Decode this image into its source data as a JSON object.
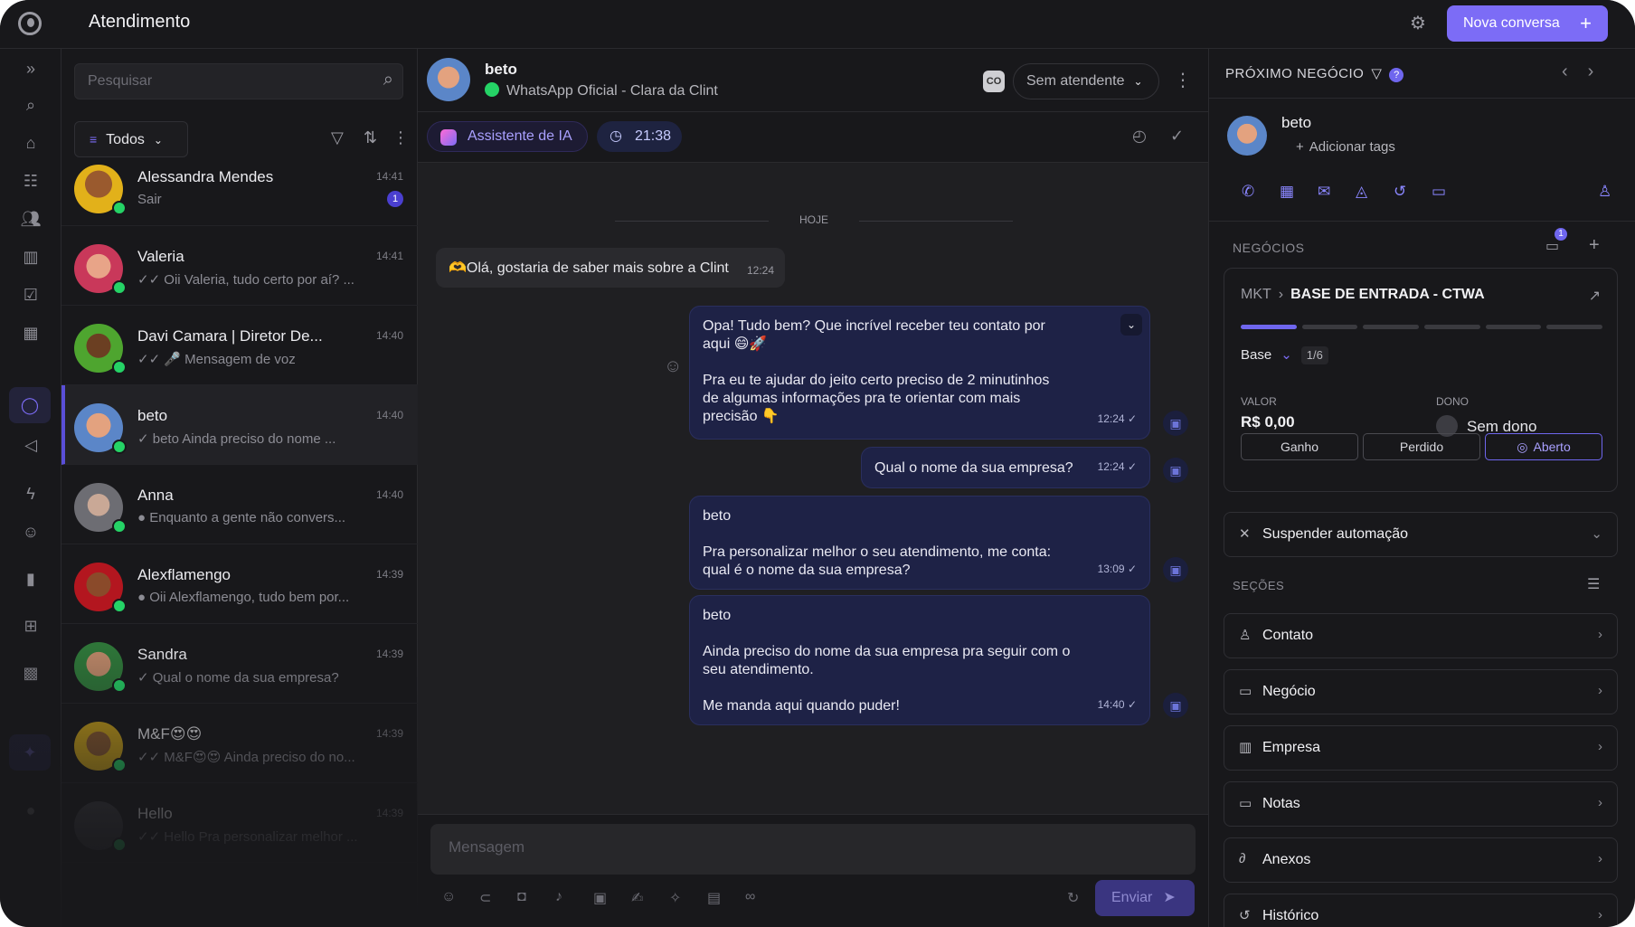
{
  "app": {
    "title": "Atendimento",
    "new_conversation": "Nova conversa"
  },
  "colors": {
    "accent": "#7c6cf6",
    "whatsapp": "#25d366",
    "background": "#18181b"
  },
  "icons": {
    "logo": "clint-logo-icon",
    "settings": "gear-icon",
    "rail": [
      "expand-icon",
      "search-icon",
      "home-icon",
      "kanban-icon",
      "users-icon",
      "building-icon",
      "tasks-icon",
      "calendar-icon",
      "chat-icon",
      "megaphone-icon",
      "lightning-icon",
      "robot-icon",
      "bar-chart-icon",
      "apps-icon",
      "grid-icon",
      "sparkle-icon",
      "person-icon"
    ]
  },
  "list": {
    "search_placeholder": "Pesquisar",
    "filter_label": "Todos",
    "conversations": [
      {
        "name": "Alessandra Mendes",
        "time": "14:41",
        "preview": "Sair",
        "badge": "1"
      },
      {
        "name": "Valeria",
        "time": "14:41",
        "preview": "✓✓ Oii Valeria, tudo certo por aí? ..."
      },
      {
        "name": "Davi Camara | Diretor De...",
        "time": "14:40",
        "preview": "✓✓ 🎤 Mensagem de voz"
      },
      {
        "name": "beto",
        "time": "14:40",
        "preview": "✓ beto Ainda preciso do nome ..."
      },
      {
        "name": "Anna",
        "time": "14:40",
        "preview": "● Enquanto a gente não convers..."
      },
      {
        "name": "Alexflamengo",
        "time": "14:39",
        "preview": "● Oii Alexflamengo, tudo bem por..."
      },
      {
        "name": "Sandra",
        "time": "14:39",
        "preview": "✓ Qual o nome da sua empresa?"
      },
      {
        "name": "M&F😍😍",
        "time": "14:39",
        "preview": "✓✓ M&F😍😍 Ainda preciso do no..."
      },
      {
        "name": "Hello",
        "time": "14:39",
        "preview": "✓✓ Hello Pra personalizar melhor ..."
      }
    ]
  },
  "chat": {
    "contact_name": "beto",
    "channel": "WhatsApp Oficial - Clara da Clint",
    "co_badge": "CO",
    "attendant": "Sem atendente",
    "ai_assistant": "Assistente de IA",
    "timer": "21:38",
    "day_separator": "HOJE",
    "incoming": {
      "text": "🫶Olá, gostaria de saber mais sobre a Clint",
      "time": "12:24"
    },
    "outgoing": [
      {
        "lines": [
          "Opa! Tudo bem? Que incrível receber teu contato por aqui 😄🚀",
          "Pra eu te ajudar do jeito certo preciso de 2 minutinhos de algumas informações pra te orientar com mais precisão 👇"
        ],
        "time": "12:24 ✓"
      },
      {
        "lines": [
          "Qual o nome da sua empresa?"
        ],
        "time": "12:24 ✓"
      },
      {
        "lines": [
          "beto",
          "Pra personalizar melhor o seu atendimento, me conta: qual é o nome da sua empresa?"
        ],
        "time": "13:09 ✓"
      },
      {
        "lines": [
          "beto",
          "Ainda preciso do nome da sua empresa pra seguir com o seu atendimento.",
          "Me manda aqui quando puder!"
        ],
        "time": "14:40 ✓"
      }
    ],
    "composer_placeholder": "Mensagem",
    "send_label": "Enviar"
  },
  "side": {
    "header": "PRÓXIMO NEGÓCIO",
    "help": "?",
    "contact_name": "beto",
    "add_tags": "Adicionar tags",
    "deals_label": "NEGÓCIOS",
    "deals_count": "1",
    "deal": {
      "pipeline": "MKT",
      "stage_name": "BASE DE ENTRADA - CTWA",
      "stage": "Base",
      "step": "1/6",
      "progress": 1,
      "stages_total": 6,
      "value_label": "VALOR",
      "value": "R$ 0,00",
      "owner_label": "DONO",
      "owner": "Sem dono",
      "won": "Ganho",
      "lost": "Perdido",
      "open": "Aberto"
    },
    "suspend": "Suspender automação",
    "sections_label": "SEÇÕES",
    "sections": [
      "Contato",
      "Negócio",
      "Empresa",
      "Notas",
      "Anexos",
      "Histórico"
    ]
  }
}
